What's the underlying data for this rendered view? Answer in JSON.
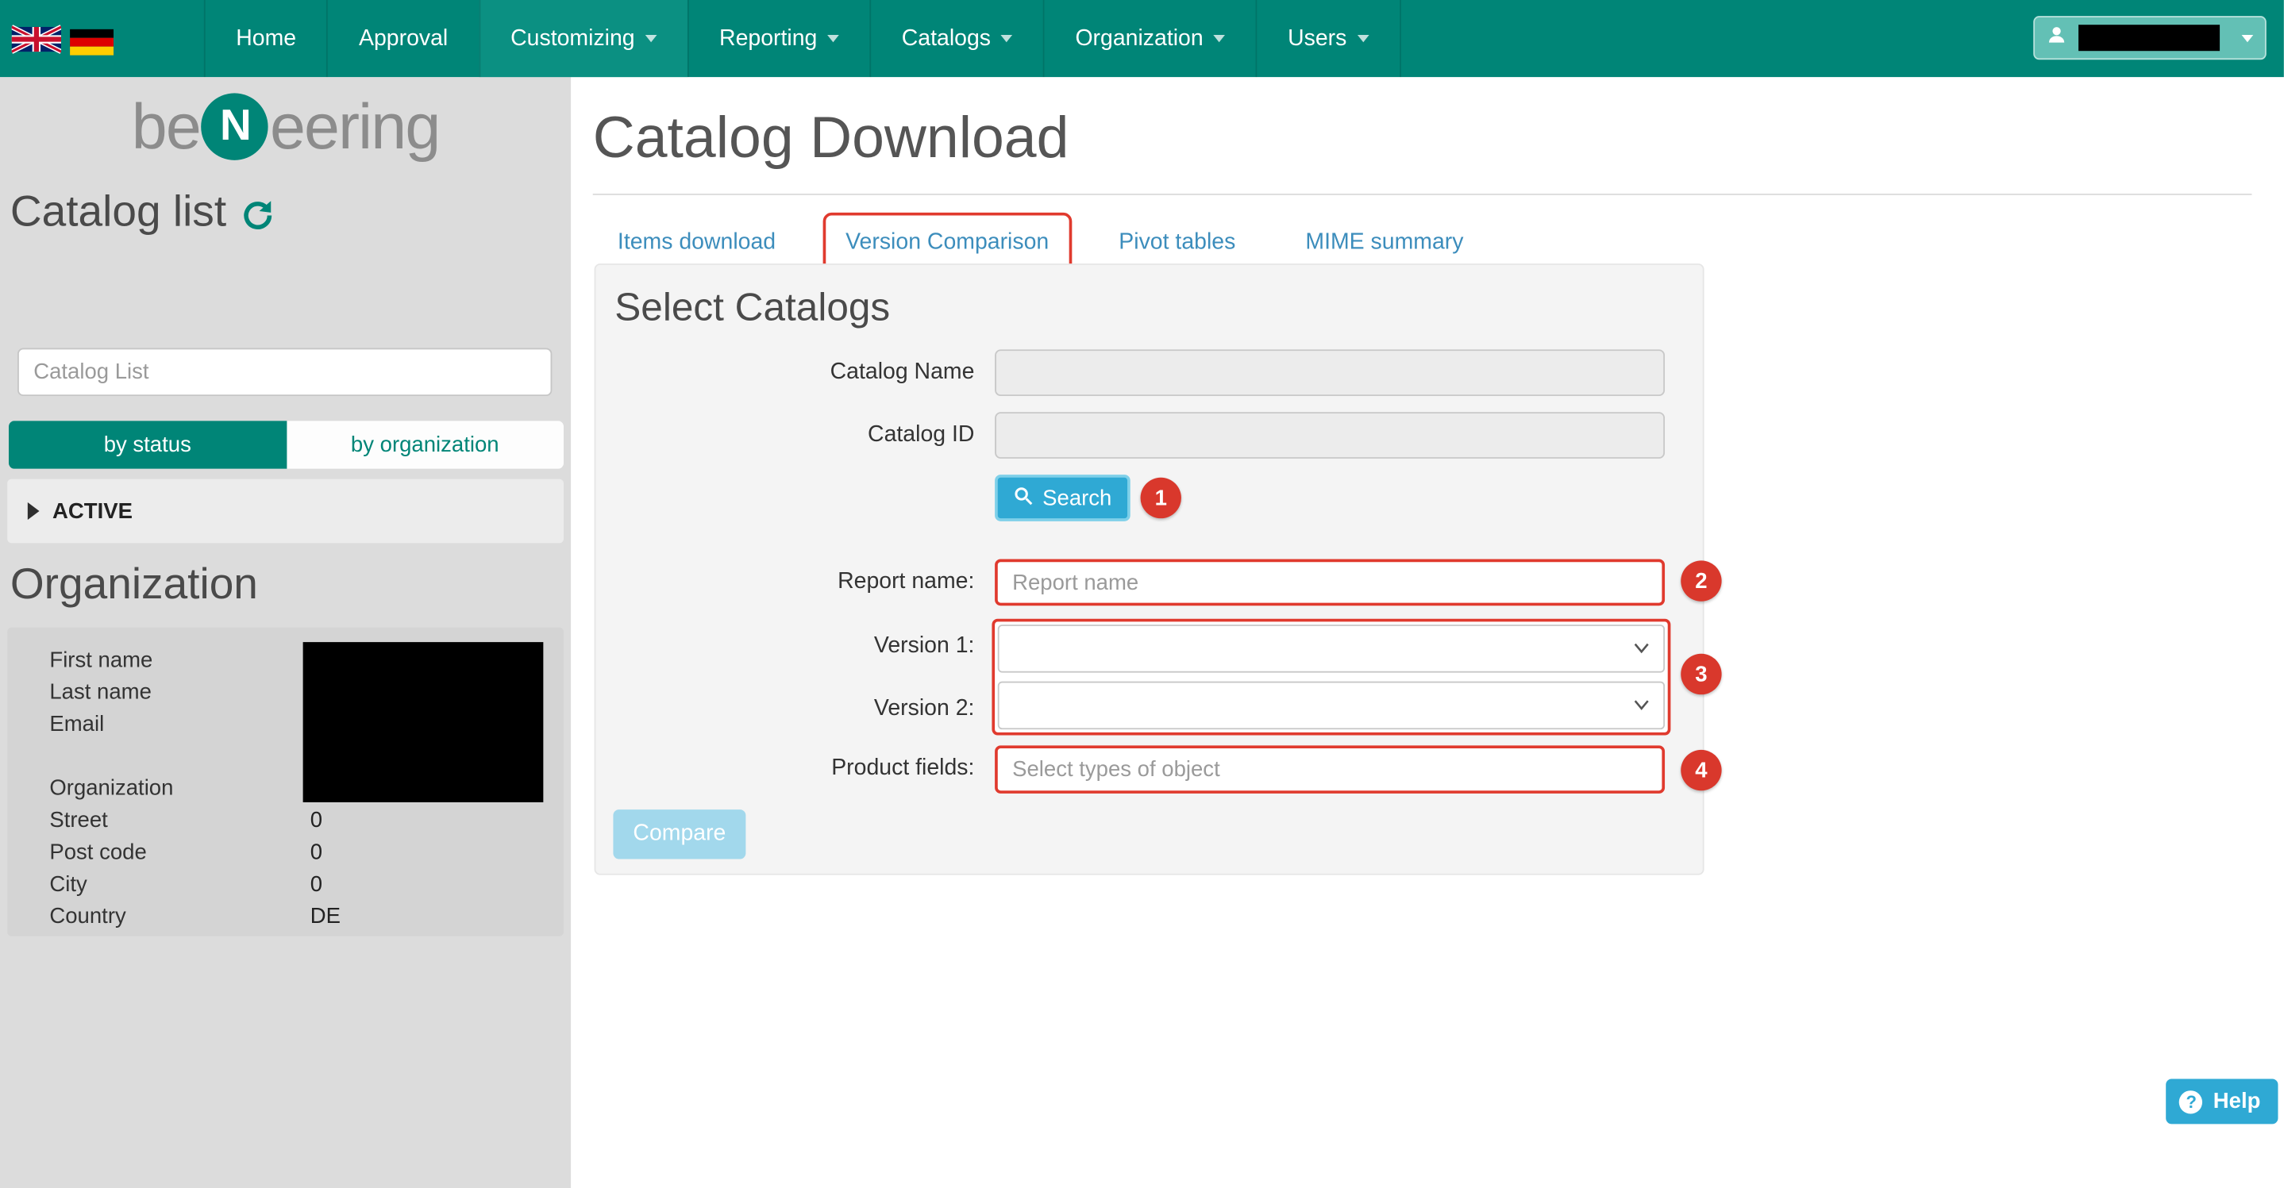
{
  "colors": {
    "navbar_teal": "#008577",
    "accent_teal": "#00857b",
    "tab_link_blue": "#3c8dbc",
    "info_button_blue": "#2fa9d4",
    "annotation_red": "#e03a2e",
    "sidebar_gray": "#dcdcdc"
  },
  "navbar": {
    "items": [
      {
        "label": "Home",
        "caret": false
      },
      {
        "label": "Approval",
        "caret": false
      },
      {
        "label": "Customizing",
        "caret": true
      },
      {
        "label": "Reporting",
        "caret": true
      },
      {
        "label": "Catalogs",
        "caret": true
      },
      {
        "label": "Organization",
        "caret": true
      },
      {
        "label": "Users",
        "caret": true
      }
    ],
    "flags": [
      "uk-flag",
      "germany-flag"
    ],
    "user": {
      "redacted": true
    }
  },
  "sidebar": {
    "logo": {
      "prefix": "be",
      "circle_letter": "N",
      "suffix": "eering"
    },
    "catalog_list": {
      "heading": "Catalog list",
      "search_placeholder": "Catalog List",
      "tabs": [
        {
          "label": "by status",
          "active": true
        },
        {
          "label": "by organization",
          "active": false
        }
      ],
      "groups": [
        {
          "label": "ACTIVE",
          "expanded": false
        }
      ]
    },
    "organization": {
      "heading": "Organization",
      "rows": [
        {
          "label": "First name",
          "value": "",
          "redacted": true
        },
        {
          "label": "Last name",
          "value": "",
          "redacted": true
        },
        {
          "label": "Email",
          "value": "",
          "redacted": true
        },
        {
          "label": "Organization",
          "value": "",
          "redacted": true
        },
        {
          "label": "Street",
          "value": "0",
          "redacted": false
        },
        {
          "label": "Post code",
          "value": "0",
          "redacted": false
        },
        {
          "label": "City",
          "value": "0",
          "redacted": false
        },
        {
          "label": "Country",
          "value": "DE",
          "redacted": false
        }
      ]
    }
  },
  "main": {
    "title": "Catalog Download",
    "tabs": [
      {
        "label": "Items download",
        "annotated": false
      },
      {
        "label": "Version Comparison",
        "annotated": true
      },
      {
        "label": "Pivot tables",
        "annotated": false
      },
      {
        "label": "MIME summary",
        "annotated": false
      }
    ],
    "panel": {
      "heading": "Select Catalogs",
      "catalog_name_label": "Catalog Name",
      "catalog_id_label": "Catalog ID",
      "search_button_label": "Search",
      "report_name_label": "Report name:",
      "report_name_placeholder": "Report name",
      "version1_label": "Version 1:",
      "version2_label": "Version 2:",
      "product_fields_label": "Product fields:",
      "product_fields_placeholder": "Select types of object",
      "compare_button_label": "Compare"
    },
    "annotations": {
      "badge1": "1",
      "badge2": "2",
      "badge3": "3",
      "badge4": "4"
    }
  },
  "help": {
    "label": "Help"
  }
}
